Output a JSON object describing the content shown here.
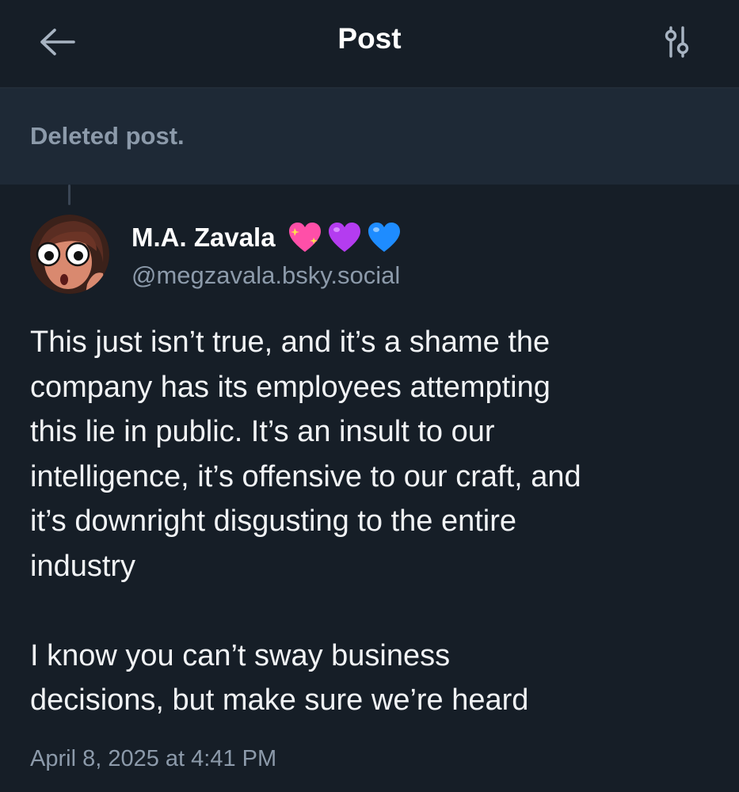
{
  "header": {
    "title": "Post",
    "back_icon": "arrow-left-icon",
    "filter_icon": "sliders-icon"
  },
  "parent_post": {
    "text": "Deleted post."
  },
  "post": {
    "author": {
      "display_name": "M.A. Zavala",
      "emojis": [
        "sparkling-heart",
        "purple-heart",
        "blue-heart"
      ],
      "handle": "@megzavala.bsky.social"
    },
    "paragraphs": [
      "This just isn’t true, and it’s a shame the\ncompany has its employees attempting\nthis lie in public. It’s an insult to our\nintelligence, it’s offensive to our craft, and\nit’s downright disgusting to the entire\nindustry",
      "I know you can’t sway business\ndecisions, but make sure we’re heard"
    ],
    "timestamp": "April 8, 2025 at 4:41 PM"
  },
  "colors": {
    "background": "#161e27",
    "deleted_background": "#1e2936",
    "muted_text": "#8c9aaa",
    "primary_text": "#f1f3f5"
  }
}
